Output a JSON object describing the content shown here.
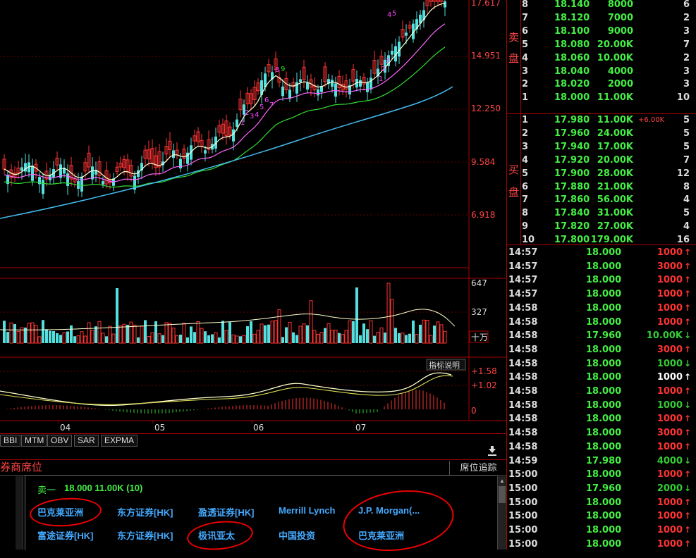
{
  "price_axis": [
    "17.617",
    "14.951",
    "12.250",
    "9.584",
    "6.918"
  ],
  "volume_axis": [
    "647",
    "327"
  ],
  "volume_unit": "十万",
  "indicator_axis": [
    "+1.58",
    "+1.02",
    "0"
  ],
  "indicator_help": "指标说明",
  "x_ticks": [
    "04",
    "05",
    "06",
    "07"
  ],
  "td_numbers": [
    "1",
    "2",
    "3",
    "4",
    "5",
    "6",
    "7",
    "8",
    "9",
    "1",
    "2",
    "3",
    "4",
    "5"
  ],
  "indicator_tabs": [
    "BBI",
    "MTM",
    "OBV",
    "SAR",
    "EXPMA"
  ],
  "download_icon": "download-arrow-icon",
  "broker_section": {
    "title": "券商席位",
    "tracker_button": "席位追踪",
    "sell1_label": "卖一",
    "sell1_value": "18.000 11.00K (10)",
    "row1": [
      "巴克莱亚洲",
      "东方证券[HK]",
      "盈透证券[HK]",
      "Merrill Lynch",
      "J.P. Morgan(..."
    ],
    "row2": [
      "富途证券[HK]",
      "东方证券[HK]",
      "极讯亚太",
      "中国投资",
      "巴克莱亚洲"
    ]
  },
  "order_book": {
    "sell_label": [
      "卖",
      "盘"
    ],
    "buy_label": [
      "买",
      "盘"
    ],
    "sell": [
      {
        "idx": "8",
        "price": "18.140",
        "vol": "8000",
        "cnt": "6"
      },
      {
        "idx": "7",
        "price": "18.120",
        "vol": "7000",
        "cnt": "2"
      },
      {
        "idx": "6",
        "price": "18.100",
        "vol": "9000",
        "cnt": "3"
      },
      {
        "idx": "5",
        "price": "18.080",
        "vol": "20.00K",
        "cnt": "7"
      },
      {
        "idx": "4",
        "price": "18.060",
        "vol": "10.00K",
        "cnt": "2"
      },
      {
        "idx": "3",
        "price": "18.040",
        "vol": "4000",
        "cnt": "3"
      },
      {
        "idx": "2",
        "price": "18.020",
        "vol": "2000",
        "cnt": "3"
      },
      {
        "idx": "1",
        "price": "18.000",
        "vol": "11.00K",
        "cnt": "10"
      }
    ],
    "buy": [
      {
        "idx": "1",
        "price": "17.980",
        "vol": "11.00K",
        "chg": "+6.00K",
        "cnt": "5"
      },
      {
        "idx": "2",
        "price": "17.960",
        "vol": "24.00K",
        "chg": "",
        "cnt": "5"
      },
      {
        "idx": "3",
        "price": "17.940",
        "vol": "17.00K",
        "chg": "",
        "cnt": "5"
      },
      {
        "idx": "4",
        "price": "17.920",
        "vol": "20.00K",
        "chg": "",
        "cnt": "7"
      },
      {
        "idx": "5",
        "price": "17.900",
        "vol": "28.00K",
        "chg": "",
        "cnt": "12"
      },
      {
        "idx": "6",
        "price": "17.880",
        "vol": "21.00K",
        "chg": "",
        "cnt": "8"
      },
      {
        "idx": "7",
        "price": "17.860",
        "vol": "56.00K",
        "chg": "",
        "cnt": "4"
      },
      {
        "idx": "8",
        "price": "17.840",
        "vol": "31.00K",
        "chg": "",
        "cnt": "5"
      },
      {
        "idx": "9",
        "price": "17.820",
        "vol": "27.00K",
        "chg": "",
        "cnt": "4"
      },
      {
        "idx": "10",
        "price": "17.800",
        "vol": "179.00K",
        "chg": "",
        "cnt": "16"
      }
    ]
  },
  "ticks": [
    {
      "t": "14:57",
      "p": "18.000",
      "v": "1000",
      "d": "up"
    },
    {
      "t": "14:57",
      "p": "18.000",
      "v": "3000",
      "d": "up"
    },
    {
      "t": "14:57",
      "p": "18.000",
      "v": "1000",
      "d": "up"
    },
    {
      "t": "14:57",
      "p": "18.000",
      "v": "1000",
      "d": "up"
    },
    {
      "t": "14:58",
      "p": "18.000",
      "v": "1000",
      "d": "up"
    },
    {
      "t": "14:58",
      "p": "18.000",
      "v": "1000",
      "d": "up"
    },
    {
      "t": "14:58",
      "p": "17.960",
      "v": "10.00K",
      "d": "down"
    },
    {
      "t": "14:58",
      "p": "18.000",
      "v": "3000",
      "d": "up"
    },
    {
      "t": "14:58",
      "p": "18.000",
      "v": "1000",
      "d": "down"
    },
    {
      "t": "14:58",
      "p": "18.000",
      "v": "1000",
      "d": "neutral"
    },
    {
      "t": "14:58",
      "p": "18.000",
      "v": "1000",
      "d": "up"
    },
    {
      "t": "14:58",
      "p": "18.000",
      "v": "1000",
      "d": "down"
    },
    {
      "t": "14:58",
      "p": "18.000",
      "v": "1000",
      "d": "up"
    },
    {
      "t": "14:58",
      "p": "18.000",
      "v": "3000",
      "d": "up"
    },
    {
      "t": "14:58",
      "p": "18.000",
      "v": "1000",
      "d": "up"
    },
    {
      "t": "14:59",
      "p": "17.980",
      "v": "4000",
      "d": "down"
    },
    {
      "t": "15:00",
      "p": "18.000",
      "v": "1000",
      "d": "up"
    },
    {
      "t": "15:00",
      "p": "17.960",
      "v": "2000",
      "d": "down"
    },
    {
      "t": "15:00",
      "p": "18.000",
      "v": "1000",
      "d": "up"
    },
    {
      "t": "15:00",
      "p": "18.000",
      "v": "1000",
      "d": "up"
    },
    {
      "t": "15:00",
      "p": "18.000",
      "v": "1000",
      "d": "up"
    },
    {
      "t": "15:00",
      "p": "18.000",
      "v": "1000",
      "d": "up"
    }
  ],
  "colors": {
    "up": "#ff3333",
    "down": "#33cc33",
    "neutral": "#ffffff",
    "cyan": "#55e0e0",
    "axis": "#aa0000"
  }
}
